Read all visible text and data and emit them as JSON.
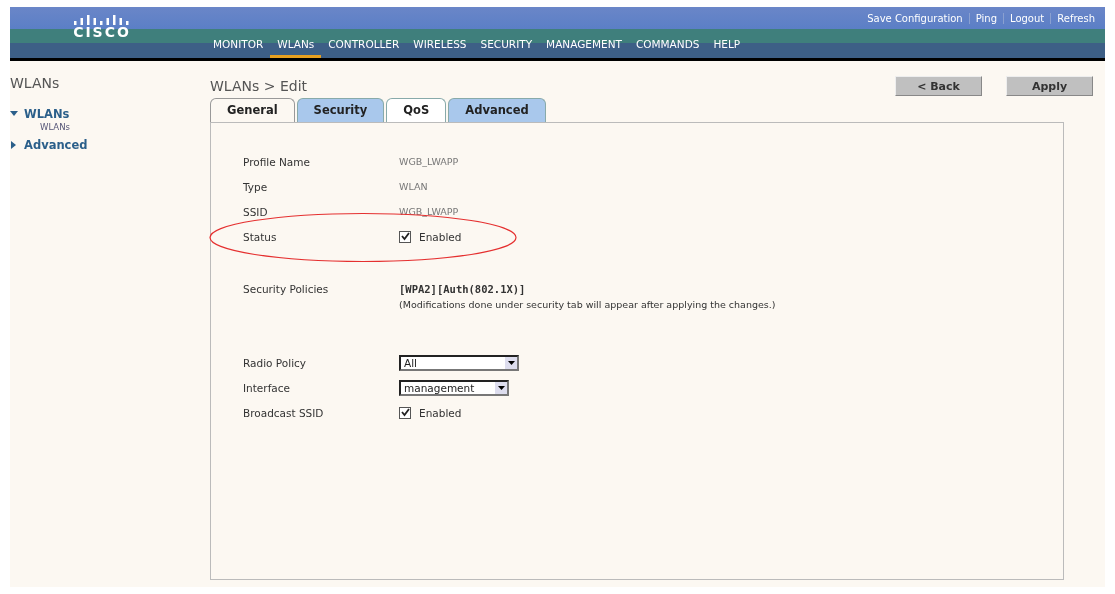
{
  "header": {
    "logo": "CISCO",
    "links": [
      "Save Configuration",
      "Ping",
      "Logout",
      "Refresh"
    ],
    "menu": [
      {
        "label": "MONITOR",
        "selected": false
      },
      {
        "label": "WLANs",
        "selected": true
      },
      {
        "label": "CONTROLLER",
        "selected": false
      },
      {
        "label": "WIRELESS",
        "selected": false
      },
      {
        "label": "SECURITY",
        "selected": false
      },
      {
        "label": "MANAGEMENT",
        "selected": false
      },
      {
        "label": "COMMANDS",
        "selected": false
      },
      {
        "label": "HELP",
        "selected": false
      }
    ]
  },
  "sidebar": {
    "title": "WLANs",
    "items": [
      {
        "label": "WLANs",
        "expanded": true,
        "children": [
          {
            "label": "WLANs"
          }
        ]
      },
      {
        "label": "Advanced",
        "expanded": false
      }
    ]
  },
  "page": {
    "title": "WLANs > Edit",
    "buttons": [
      "< Back",
      "Apply"
    ],
    "tabs": [
      {
        "label": "General",
        "selected": true,
        "hover": false
      },
      {
        "label": "Security",
        "selected": false,
        "hover": false
      },
      {
        "label": "QoS",
        "selected": false,
        "hover": true
      },
      {
        "label": "Advanced",
        "selected": false,
        "hover": false
      }
    ],
    "groups": [
      [
        {
          "kind": "text",
          "label": "Profile Name",
          "value": "WGB_LWAPP"
        },
        {
          "kind": "text",
          "label": "Type",
          "value": "WLAN"
        },
        {
          "kind": "text",
          "label": "SSID",
          "value": "WGB_LWAPP"
        },
        {
          "kind": "checkbox",
          "label": "Status",
          "checked": true,
          "text": "Enabled",
          "circled": true
        }
      ],
      [
        {
          "kind": "policy",
          "label": "Security Policies",
          "value": "[WPA2][Auth(802.1X)]",
          "note": "(Modifications done under security tab will appear after applying the changes.)"
        }
      ],
      [
        {
          "kind": "select",
          "label": "Radio Policy",
          "value": "All"
        },
        {
          "kind": "select",
          "label": "Interface",
          "value": "management"
        },
        {
          "kind": "checkbox",
          "label": "Broadcast SSID",
          "checked": true,
          "text": "Enabled",
          "circled": false
        }
      ]
    ]
  }
}
